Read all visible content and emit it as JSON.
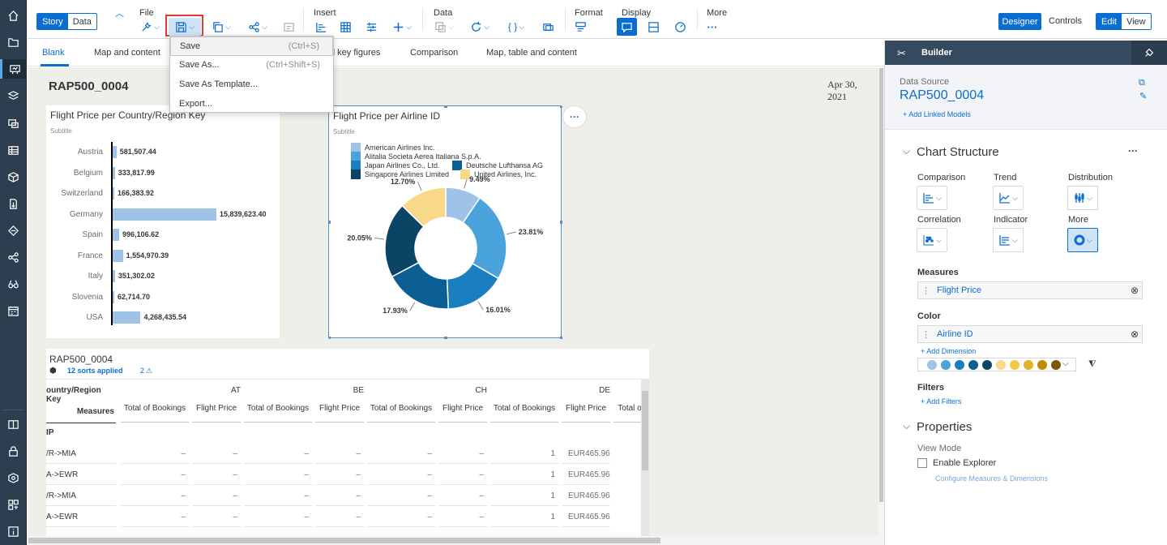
{
  "toolbar": {
    "story_label": "Story",
    "data_label": "Data",
    "groups": {
      "file": "File",
      "insert": "Insert",
      "data": "Data",
      "format": "Format",
      "display": "Display",
      "more": "More"
    },
    "designer_label": "Designer",
    "controls_label": "Controls",
    "edit_label": "Edit",
    "view_label": "View"
  },
  "page_tabs": [
    "Blank",
    "Map and content",
    "d key figures",
    "Comparison",
    "Map, table and content"
  ],
  "file_menu": {
    "items": [
      {
        "label": "Save",
        "shortcut": "(Ctrl+S)"
      },
      {
        "label": "Save As...",
        "shortcut": "(Ctrl+Shift+S)"
      },
      {
        "label": "Save As Template...",
        "shortcut": ""
      },
      {
        "label": "Export...",
        "shortcut": ""
      }
    ]
  },
  "story": {
    "title": "RAP500_0004",
    "date": "Apr 30, 2021"
  },
  "chart_data": [
    {
      "type": "bar",
      "title": "Flight Price per Country/Region Key",
      "subtitle": "Subtitle",
      "categories": [
        "Austria",
        "Belgium",
        "Switzerland",
        "Germany",
        "Spain",
        "France",
        "Italy",
        "Slovenia",
        "USA"
      ],
      "values": [
        581507.44,
        333817.99,
        166383.92,
        15839623.4,
        996106.62,
        1554970.39,
        351302.02,
        62714.7,
        4268435.54
      ],
      "labels": [
        "581,507.44",
        "333,817.99",
        "166,383.92",
        "15,839,623.40",
        "996,106.62",
        "1,554,970.39",
        "351,302.02",
        "62,714.70",
        "4,268,435.54"
      ],
      "orientation": "horizontal",
      "color": "#9fc3e6"
    },
    {
      "type": "pie",
      "title": "Flight Price per Airline ID",
      "subtitle": "Subtitle",
      "donut": true,
      "legend_placement": "top-left",
      "series": [
        {
          "name": "American Airlines Inc.",
          "value": 9.49,
          "label": "9.49%",
          "color": "#9fc3e6"
        },
        {
          "name": "Alitalia Societa Aerea Italiana S.p.A.",
          "value": 23.81,
          "label": "23.81%",
          "color": "#4ba3dc"
        },
        {
          "name": "Japan Airlines Co., Ltd.",
          "value": 16.01,
          "label": "16.01%",
          "color": "#1a7fc1"
        },
        {
          "name": "Deutsche Lufthansa AG",
          "value": 17.93,
          "label": "17.93%",
          "color": "#0c5f94"
        },
        {
          "name": "Singapore Airlines Limited",
          "value": 20.05,
          "label": "20.05%",
          "color": "#0b4566"
        },
        {
          "name": "United Airlines, Inc.",
          "value": 12.7,
          "label": "12.70%",
          "color": "#f8d98a"
        }
      ]
    }
  ],
  "table": {
    "title": "RAP500_0004",
    "sorts_label": "12 sorts applied",
    "warnings_label": "2",
    "dim_header": "ountry/Region Key",
    "measures_label": "Measures",
    "row_dim_label": "IP",
    "countries": [
      "AT",
      "BE",
      "CH",
      "DE"
    ],
    "measure_cols": [
      "Total of Bookings",
      "Flight Price",
      "Total of Bookings",
      "Flight Price",
      "Total of Bookings",
      "Flight Price",
      "Total of Bookings",
      "Flight Price",
      "Total o"
    ],
    "rows": [
      {
        "label": "/R->MIA",
        "cells": [
          "–",
          "–",
          "–",
          "–",
          "–",
          "–",
          "1",
          "EUR465.96"
        ]
      },
      {
        "label": "A->EWR",
        "cells": [
          "–",
          "–",
          "–",
          "–",
          "–",
          "–",
          "1",
          "EUR465.96"
        ]
      },
      {
        "label": "/R->MIA",
        "cells": [
          "–",
          "–",
          "–",
          "–",
          "–",
          "–",
          "1",
          "EUR465.96"
        ]
      },
      {
        "label": "A->EWR",
        "cells": [
          "–",
          "–",
          "–",
          "–",
          "–",
          "–",
          "1",
          "EUR465.96"
        ]
      }
    ]
  },
  "builder": {
    "title": "Builder",
    "data_source_label": "Data Source",
    "data_source": "RAP500_0004",
    "add_linked_models": "Add Linked Models",
    "chart_structure_label": "Chart Structure",
    "chart_types": [
      "Comparison",
      "Trend",
      "Distribution",
      "Correlation",
      "Indicator",
      "More"
    ],
    "measures_label": "Measures",
    "measure_token": "Flight Price",
    "color_label": "Color",
    "color_token": "Airline ID",
    "add_dimension": "Add Dimension",
    "palette": [
      "#9fc3e6",
      "#4ba3dc",
      "#1a7fc1",
      "#0c5f94",
      "#0b4566",
      "#f8d98a",
      "#f5c84a",
      "#e2b128",
      "#c08a0c",
      "#7a5a0a"
    ],
    "filters_label": "Filters",
    "add_filters": "Add Filters",
    "properties_label": "Properties",
    "view_mode_label": "View Mode",
    "enable_explorer": "Enable Explorer",
    "configure_link": "Configure Measures & Dimensions"
  }
}
